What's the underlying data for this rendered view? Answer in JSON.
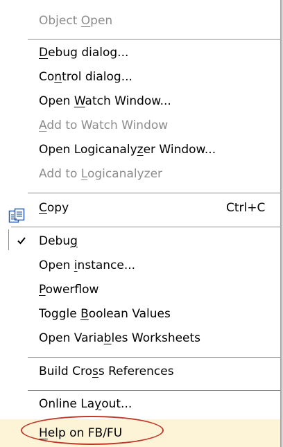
{
  "menu": {
    "items": [
      {
        "pre": "Object ",
        "ul": "O",
        "post": "pen",
        "disabled": true
      },
      {
        "pre": "",
        "ul": "D",
        "post": "ebug dialog...",
        "disabled": false
      },
      {
        "pre": "Co",
        "ul": "n",
        "post": "trol dialog...",
        "disabled": false
      },
      {
        "pre": "Open ",
        "ul": "W",
        "post": "atch Window...",
        "disabled": false
      },
      {
        "pre": "",
        "ul": "A",
        "post": "dd to Watch Window",
        "disabled": true
      },
      {
        "pre": "Open Logicanaly",
        "ul": "z",
        "post": "er Window...",
        "disabled": false
      },
      {
        "pre": "Add to ",
        "ul": "L",
        "post": "ogicanalyzer",
        "disabled": true
      },
      {
        "pre": "",
        "ul": "C",
        "post": "opy",
        "disabled": false,
        "shortcut": "Ctrl+C",
        "icon": "copy-icon"
      },
      {
        "pre": "Debu",
        "ul": "g",
        "post": "",
        "disabled": false,
        "checked": true
      },
      {
        "pre": "Open ",
        "ul": "i",
        "post": "nstance...",
        "disabled": false
      },
      {
        "pre": "",
        "ul": "P",
        "post": "owerflow",
        "disabled": false
      },
      {
        "pre": "Toggle ",
        "ul": "B",
        "post": "oolean Values",
        "disabled": false
      },
      {
        "pre": "Open Varia",
        "ul": "b",
        "post": "les Worksheets",
        "disabled": false
      },
      {
        "pre": "Build Cro",
        "ul": "s",
        "post": "s References",
        "disabled": false
      },
      {
        "pre": "Online La",
        "ul": "y",
        "post": "out...",
        "disabled": false
      },
      {
        "pre": "",
        "ul": "H",
        "post": "elp on FB/FU",
        "disabled": false,
        "highlighted": true
      }
    ]
  },
  "colors": {
    "annotation_oval": "#c0392b",
    "disabled_text": "#8c8c8c",
    "highlight_bg": "#fdf4d8"
  }
}
